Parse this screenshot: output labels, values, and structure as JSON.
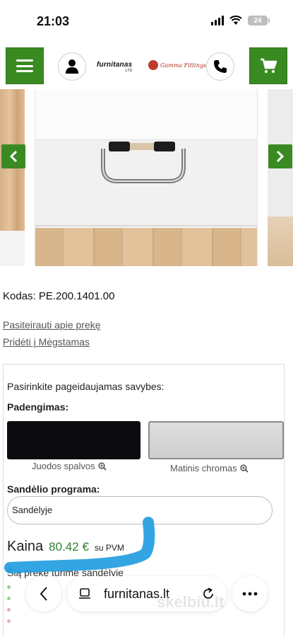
{
  "status": {
    "time": "21:03",
    "battery": "24"
  },
  "header": {
    "brand": "furnitanas",
    "brand_sub": "LTD",
    "partner": "Gamma Fittings"
  },
  "product": {
    "code_label": "Kodas:",
    "code_value": "PE.200.1401.00",
    "inquire_link": "Pasiteirauti apie prekę",
    "favorite_link": "Pridėti į Mėgstamas"
  },
  "options": {
    "title": "Pasirinkite pageidaujamas savybes:",
    "coating_label": "Padengimas:",
    "swatches": [
      {
        "caption": "Juodos spalvos",
        "color": "#0c0c10"
      },
      {
        "caption": "Matinis chromas",
        "color": "#d6d6d6"
      }
    ],
    "program_label": "Sandėlio programa:",
    "program_value": "Sandėlyje"
  },
  "price": {
    "label": "Kaina",
    "value": "80.42",
    "currency": "€",
    "tax": "su PVM"
  },
  "stock": {
    "text": "Šią prekę turime sandėlyje"
  },
  "browser": {
    "url": "furnitanas.lt"
  },
  "watermark": "skelbiu.lt",
  "colors": {
    "accent": "#3a8a22",
    "price": "#2e7d32",
    "highlight": "#1e9be0"
  }
}
